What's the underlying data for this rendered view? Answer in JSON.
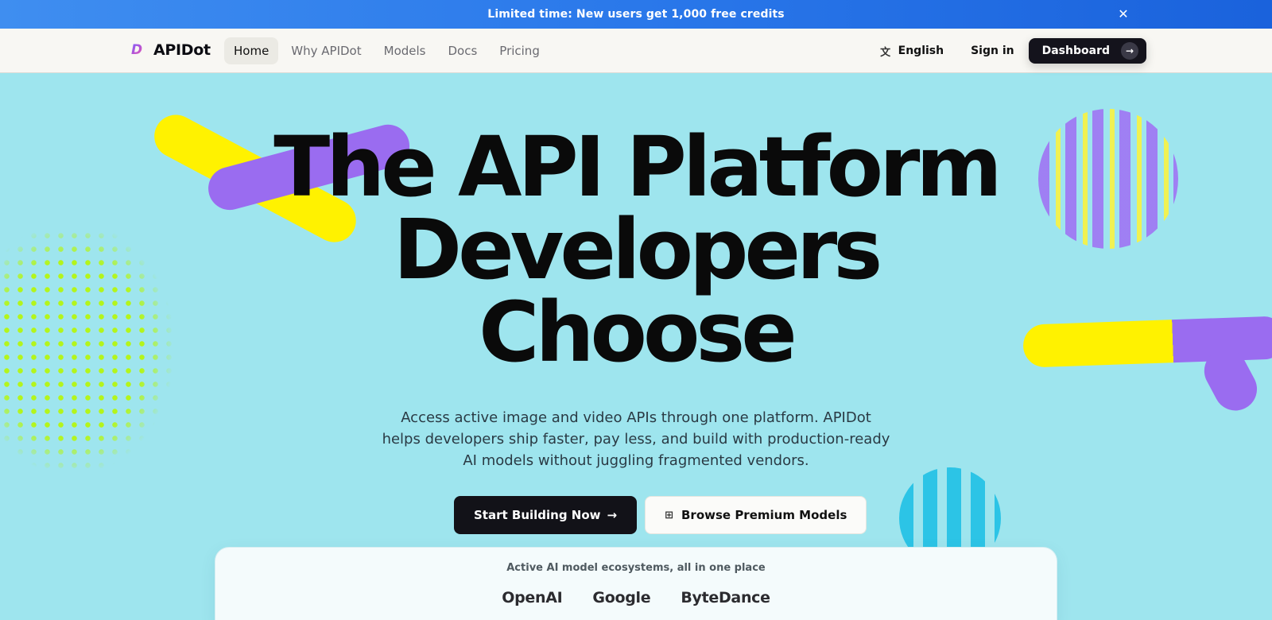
{
  "banner": {
    "text": "Limited time: New users get 1,000 free credits",
    "close_icon": "close-icon"
  },
  "nav": {
    "logo_text": "APIDot",
    "logo_mark": "D",
    "links": [
      "Home",
      "Why APIDot",
      "Models",
      "Docs",
      "Pricing"
    ],
    "active": "Home",
    "language": "English",
    "sign_in": "Sign in",
    "dashboard": "Dashboard"
  },
  "hero": {
    "title_line1": "The API Platform",
    "title_line2": "Developers",
    "title_line3": "Choose",
    "subtitle": "Access active image and video APIs through one platform. APIDot helps developers ship faster, pay less, and build with production-ready AI models without juggling fragmented vendors.",
    "primary_cta": "Start Building Now",
    "secondary_cta": "Browse Premium Models"
  },
  "ecosystems": {
    "caption": "Active AI model ecosystems, all in one place",
    "brands": [
      "OpenAI",
      "Google",
      "ByteDance"
    ]
  },
  "colors": {
    "background": "#9ee5ee",
    "banner": "#2a78ea",
    "accent_yellow": "#fff200",
    "accent_purple": "#9a6cf0",
    "accent_lime": "#b4f51a",
    "dark": "#121218"
  }
}
